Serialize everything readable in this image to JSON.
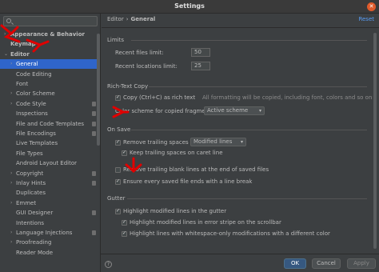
{
  "window": {
    "title": "Settings",
    "close_glyph": "✕"
  },
  "sidebar": {
    "tree": [
      {
        "label": "Appearance & Behavior",
        "arrow": "›",
        "bold": true,
        "level": 0
      },
      {
        "label": "Keymap",
        "arrow": "",
        "bold": true,
        "level": 0
      },
      {
        "label": "Editor",
        "arrow": "⌄",
        "bold": true,
        "level": 0
      },
      {
        "label": "General",
        "arrow": "›",
        "level": 1,
        "selected": true
      },
      {
        "label": "Code Editing",
        "arrow": "",
        "level": 1
      },
      {
        "label": "Font",
        "arrow": "",
        "level": 1
      },
      {
        "label": "Color Scheme",
        "arrow": "›",
        "level": 1
      },
      {
        "label": "Code Style",
        "arrow": "›",
        "level": 1,
        "badge": true
      },
      {
        "label": "Inspections",
        "arrow": "",
        "level": 1,
        "badge": true
      },
      {
        "label": "File and Code Templates",
        "arrow": "",
        "level": 1,
        "badge": true
      },
      {
        "label": "File Encodings",
        "arrow": "",
        "level": 1,
        "badge": true
      },
      {
        "label": "Live Templates",
        "arrow": "",
        "level": 1
      },
      {
        "label": "File Types",
        "arrow": "",
        "level": 1
      },
      {
        "label": "Android Layout Editor",
        "arrow": "",
        "level": 1
      },
      {
        "label": "Copyright",
        "arrow": "›",
        "level": 1,
        "badge": true
      },
      {
        "label": "Inlay Hints",
        "arrow": "›",
        "level": 1,
        "badge": true
      },
      {
        "label": "Duplicates",
        "arrow": "",
        "level": 1
      },
      {
        "label": "Emmet",
        "arrow": "›",
        "level": 1
      },
      {
        "label": "GUI Designer",
        "arrow": "",
        "level": 1,
        "badge": true
      },
      {
        "label": "Intentions",
        "arrow": "",
        "level": 1
      },
      {
        "label": "Language Injections",
        "arrow": "›",
        "level": 1,
        "badge": true
      },
      {
        "label": "Proofreading",
        "arrow": "›",
        "level": 1
      },
      {
        "label": "Reader Mode",
        "arrow": "",
        "level": 1
      }
    ]
  },
  "header": {
    "crumb1": "Editor",
    "sep": "›",
    "crumb2": "General",
    "reset": "Reset"
  },
  "limits": {
    "title": "Limits",
    "recent_files_label": "Recent files limit:",
    "recent_files_value": "50",
    "recent_locations_label": "Recent locations limit:",
    "recent_locations_value": "25"
  },
  "richtext": {
    "title": "Rich-Text Copy",
    "copy_label": "Copy (Ctrl+C) as rich text",
    "copy_checked": true,
    "copy_hint": "All formatting will be copied, including font, colors and so on",
    "scheme_label": "Color scheme for copied fragment:",
    "scheme_value": "Active scheme"
  },
  "onsave": {
    "title": "On Save",
    "remove_trailing_label": "Remove trailing spaces on:",
    "remove_trailing_checked": true,
    "remove_trailing_value": "Modified lines",
    "keep_caret_label": "Keep trailing spaces on caret line",
    "keep_caret_checked": true,
    "remove_blank_label": "Remove trailing blank lines at the end of saved files",
    "remove_blank_checked": false,
    "ensure_line_break_label": "Ensure every saved file ends with a line break",
    "ensure_line_break_checked": true
  },
  "gutter": {
    "title": "Gutter",
    "highlight_modified_label": "Highlight modified lines in the gutter",
    "highlight_modified_checked": true,
    "highlight_stripe_label": "Highlight modified lines in error stripe on the scrollbar",
    "highlight_stripe_checked": true,
    "highlight_whitespace_label": "Highlight lines with whitespace-only modifications with a different color",
    "highlight_whitespace_checked": true
  },
  "footer": {
    "help": "?",
    "ok": "OK",
    "cancel": "Cancel",
    "apply": "Apply"
  },
  "colors": {
    "accent": "#2f65ca",
    "annotation": "#e00000"
  },
  "icons": {
    "search": "search-icon",
    "dropdown": "chevron-down-icon",
    "close": "close-icon"
  }
}
